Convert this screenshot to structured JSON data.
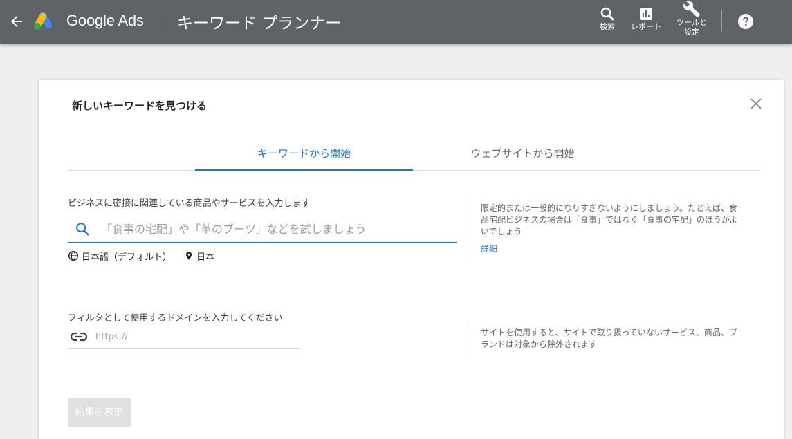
{
  "topbar": {
    "brand": "Google Ads",
    "page_title": "キーワード プランナー",
    "tools": [
      {
        "label": "検索",
        "icon": "search-icon"
      },
      {
        "label": "レポート",
        "icon": "bar-chart-icon"
      },
      {
        "label_line1": "ツールと",
        "label_line2": "設定",
        "icon": "wrench-icon"
      }
    ]
  },
  "dialog": {
    "title": "新しいキーワードを見つける",
    "tabs": [
      {
        "label": "キーワードから開始",
        "active": true
      },
      {
        "label": "ウェブサイトから開始",
        "active": false
      }
    ],
    "keyword_section": {
      "label": "ビジネスに密接に関連している商品やサービスを入力します",
      "placeholder": "「食事の宅配」や「革のブーツ」などを試しましょう",
      "language": "日本語（デフォルト）",
      "location": "日本",
      "hint": "限定的または一般的になりすぎないようにしましょう。たとえば、食品宅配ビジネスの場合は「食事」ではなく「食事の宅配」のほうがよいでしょう",
      "hint_link": "詳細"
    },
    "domain_section": {
      "label": "フィルタとして使用するドメインを入力してください",
      "placeholder": "https://",
      "hint": "サイトを使用すると、サイトで取り扱っていないサービス、商品、ブランドは対象から除外されます"
    },
    "submit_label": "結果を表示"
  },
  "colors": {
    "topbar_bg": "#5f6368",
    "accent": "#1a73e8",
    "page_bg": "#efefef"
  }
}
